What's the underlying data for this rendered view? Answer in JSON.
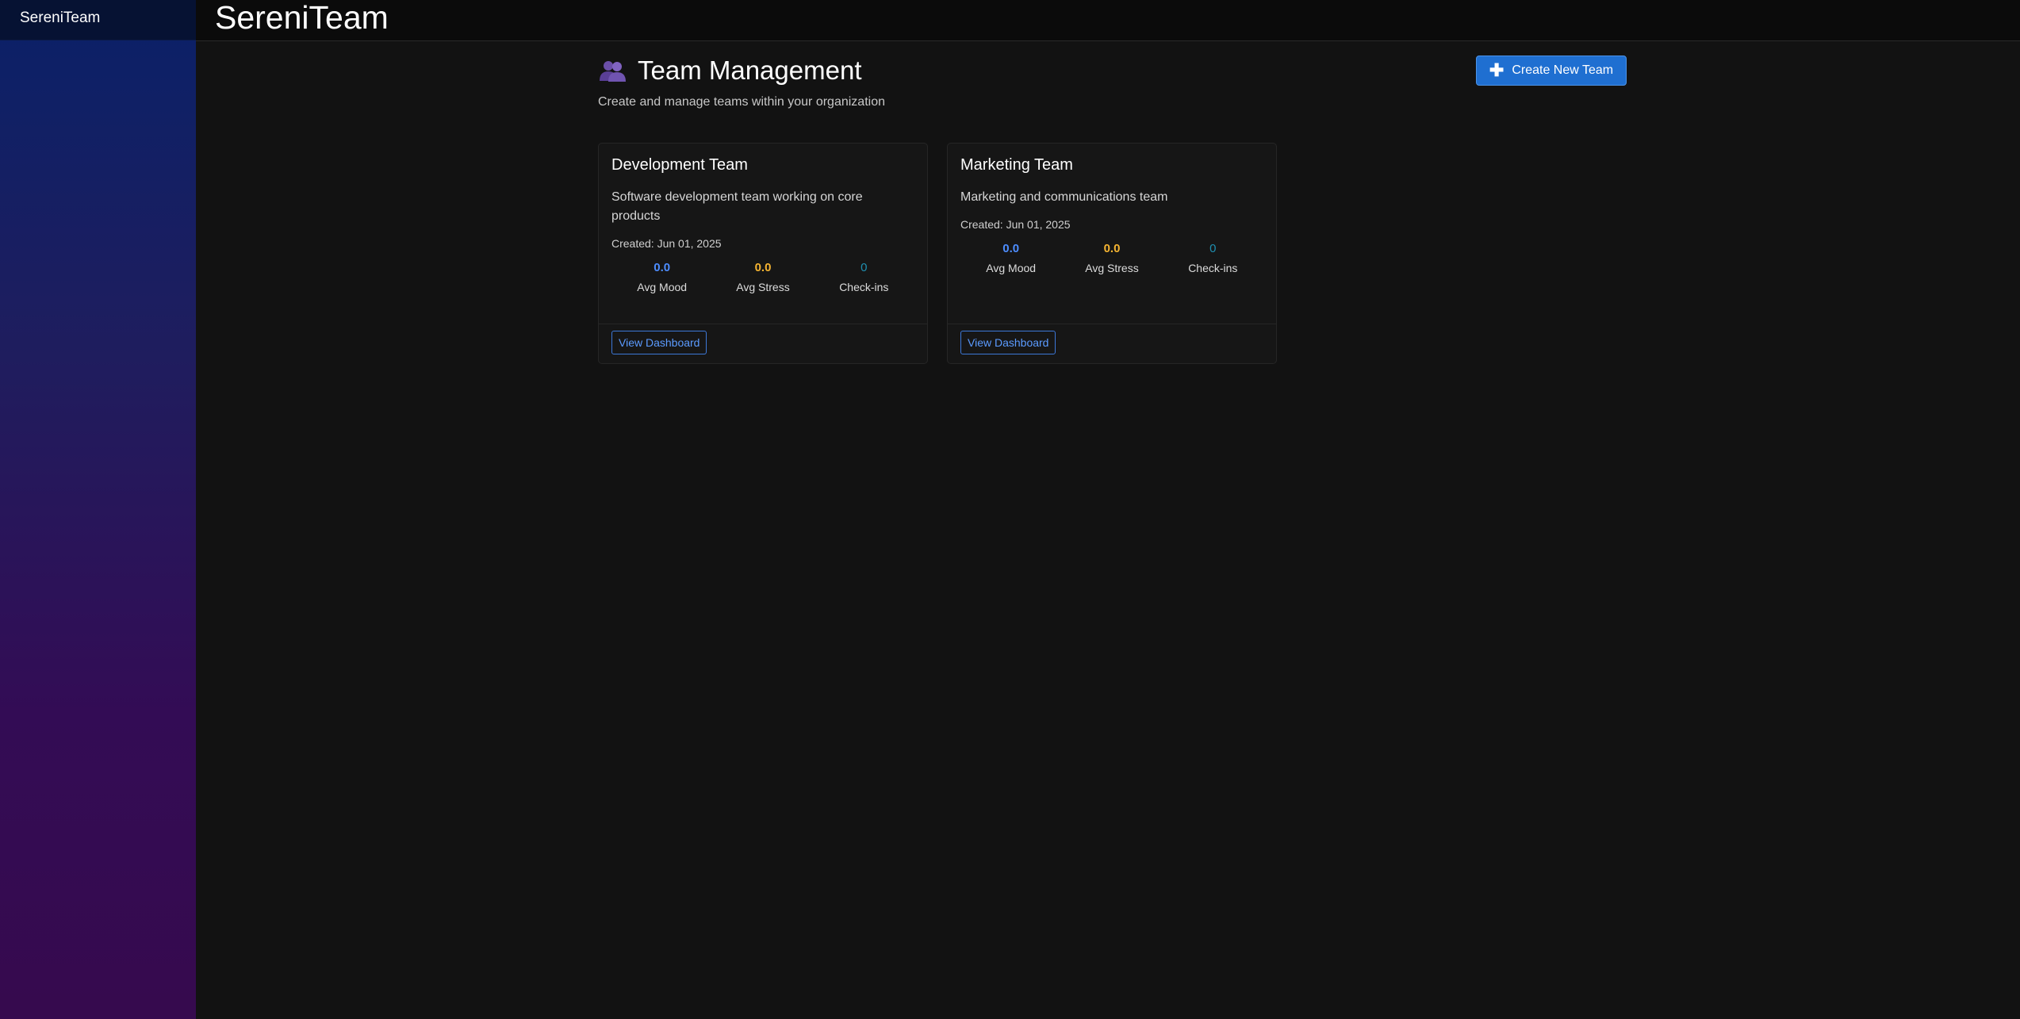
{
  "sidebar": {
    "brand": "SereniTeam"
  },
  "topbar": {
    "title": "SereniTeam"
  },
  "header": {
    "title": "Team Management",
    "subtitle": "Create and manage teams within your organization",
    "create_button": "Create New Team",
    "icon": "people-icon",
    "button_icon": "plus-icon"
  },
  "colors": {
    "accent": "#1f6fd1",
    "mood": "#4d8dff",
    "stress": "#f5b431",
    "checkins": "#1f8fb0"
  },
  "teams": [
    {
      "name": "Development Team",
      "description": "Software development team working on core products",
      "created": "Created: Jun 01, 2025",
      "avg_mood": "0.0",
      "avg_mood_label": "Avg Mood",
      "avg_stress": "0.0",
      "avg_stress_label": "Avg Stress",
      "checkins": "0",
      "checkins_label": "Check-ins",
      "button": "View Dashboard"
    },
    {
      "name": "Marketing Team",
      "description": "Marketing and communications team",
      "created": "Created: Jun 01, 2025",
      "avg_mood": "0.0",
      "avg_mood_label": "Avg Mood",
      "avg_stress": "0.0",
      "avg_stress_label": "Avg Stress",
      "checkins": "0",
      "checkins_label": "Check-ins",
      "button": "View Dashboard"
    }
  ]
}
